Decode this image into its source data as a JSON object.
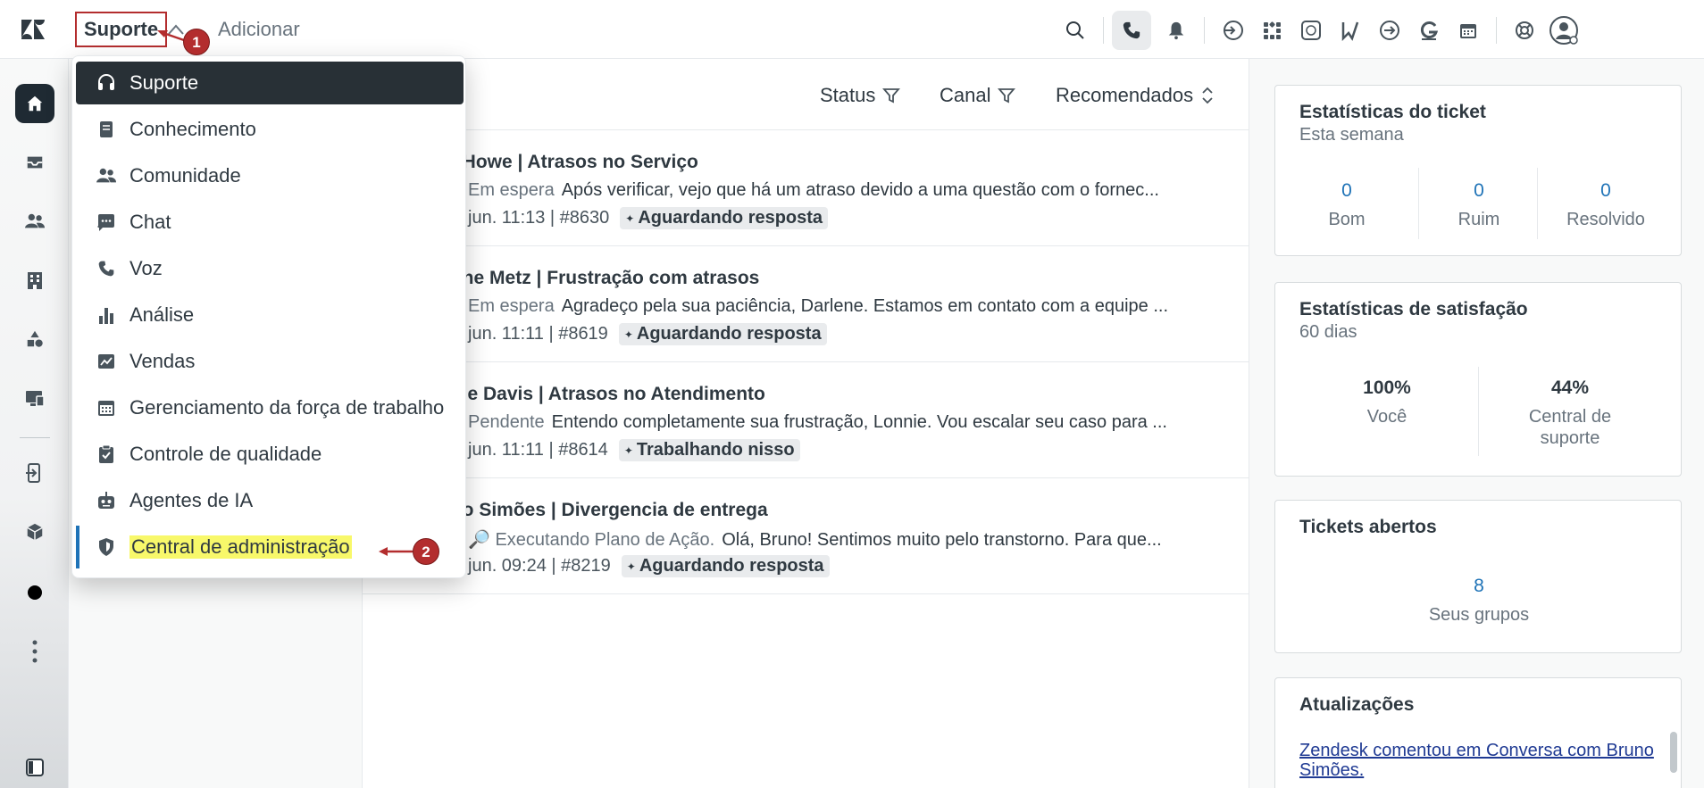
{
  "topbar": {
    "product_label": "Suporte",
    "add_label": "Adicionar"
  },
  "dropdown": {
    "items": [
      {
        "label": "Suporte",
        "icon": "headset-icon"
      },
      {
        "label": "Conhecimento",
        "icon": "book-icon"
      },
      {
        "label": "Comunidade",
        "icon": "people-icon"
      },
      {
        "label": "Chat",
        "icon": "chat-icon"
      },
      {
        "label": "Voz",
        "icon": "phone-icon"
      },
      {
        "label": "Análise",
        "icon": "bar-chart-icon"
      },
      {
        "label": "Vendas",
        "icon": "sales-icon"
      },
      {
        "label": "Gerenciamento da força de trabalho",
        "icon": "calendar-icon"
      },
      {
        "label": "Controle de qualidade",
        "icon": "clipboard-check-icon"
      },
      {
        "label": "Agentes de IA",
        "icon": "robot-icon"
      },
      {
        "label": "Central de administração",
        "icon": "shield-icon"
      }
    ]
  },
  "filters": {
    "status": "Status",
    "channel": "Canal",
    "sort": "Recomendados"
  },
  "tickets": [
    {
      "title": "th Howe | Atrasos no Serviço",
      "status": "Em espera",
      "preview": "Após verificar, vejo que há um atraso devido a uma questão com o fornec...",
      "meta": "jun. 11:13 | #8630",
      "tag": "Aguardando resposta"
    },
    {
      "title": "rlene Metz | Frustração com atrasos",
      "status": "Em espera",
      "preview": "Agradeço pela sua paciência, Darlene. Estamos em contato com a equipe ...",
      "meta": "jun. 11:11 | #8619",
      "tag": "Aguardando resposta"
    },
    {
      "title": "nnie Davis | Atrasos no Atendimento",
      "status": "Pendente",
      "preview": "Entendo completamente sua frustração, Lonnie. Vou escalar seu caso para ...",
      "meta": "jun. 11:11 | #8614",
      "tag": "Trabalhando nisso"
    },
    {
      "title": "uno Simões | Divergencia de entrega",
      "status": "🔎 Executando Plano de Ação.",
      "preview": "Olá, Bruno! Sentimos muito pelo transtorno. Para que...",
      "meta": "jun. 09:24 | #8219",
      "tag": "Aguardando resposta"
    }
  ],
  "ticket_stats": {
    "title": "Estatísticas do ticket",
    "period": "Esta semana",
    "items": [
      {
        "value": "0",
        "label": "Bom"
      },
      {
        "value": "0",
        "label": "Ruim"
      },
      {
        "value": "0",
        "label": "Resolvido"
      }
    ]
  },
  "satisfaction": {
    "title": "Estatísticas de satisfação",
    "period": "60 dias",
    "items": [
      {
        "value": "100%",
        "label": "Você"
      },
      {
        "value": "44%",
        "label": "Central de suporte"
      }
    ]
  },
  "open_tickets": {
    "title": "Tickets abertos",
    "value": "8",
    "label": "Seus grupos"
  },
  "updates": {
    "title": "Atualizações",
    "link": "Zendesk comentou em Conversa com Bruno Simões."
  },
  "annotations": {
    "step1": "1",
    "step2": "2"
  },
  "colors": {
    "annotation_red": "#b32d2e",
    "highlight_yellow": "#f8f86a",
    "link_blue": "#1f73b7",
    "selected_dark": "#283036"
  }
}
